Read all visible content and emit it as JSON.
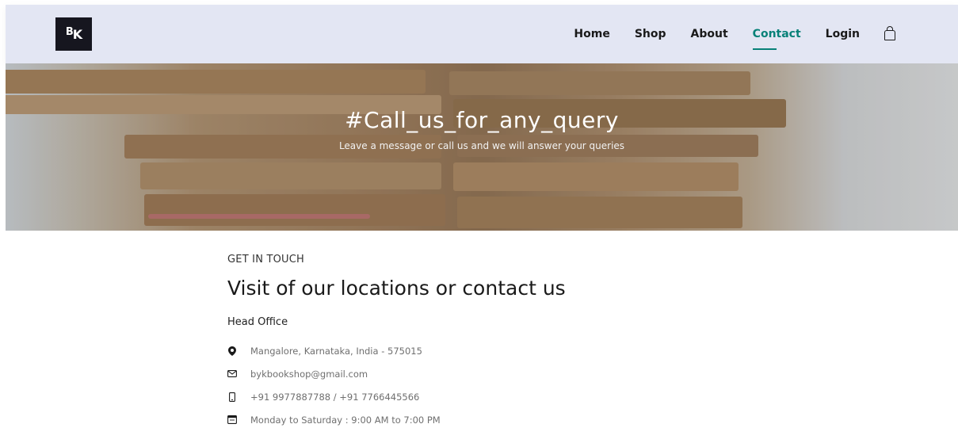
{
  "brand": {
    "logo_text_b": "B",
    "logo_text_k": "K"
  },
  "nav": {
    "items": [
      {
        "label": "Home",
        "active": false
      },
      {
        "label": "Shop",
        "active": false
      },
      {
        "label": "About",
        "active": false
      },
      {
        "label": "Contact",
        "active": true
      },
      {
        "label": "Login",
        "active": false
      }
    ],
    "cart_icon": "shopping-bag-icon",
    "accent_color": "#088178",
    "header_bg": "#e3e6f3"
  },
  "hero": {
    "title": "#Call_us_for_any_query",
    "subtitle": "Leave a message or call us and we will answer your queries"
  },
  "contact": {
    "eyebrow": "GET IN TOUCH",
    "heading": "Visit of our locations or contact us",
    "office_label": "Head Office",
    "items": [
      {
        "icon": "location-pin-icon",
        "text": "Mangalore, Karnataka, India - 575015"
      },
      {
        "icon": "envelope-icon",
        "text": "bykbookshop@gmail.com"
      },
      {
        "icon": "phone-icon",
        "text": "+91 9977887788 / +91 7766445566"
      },
      {
        "icon": "calendar-icon",
        "text": "Monday to Saturday : 9:00 AM to 7:00 PM"
      }
    ]
  }
}
